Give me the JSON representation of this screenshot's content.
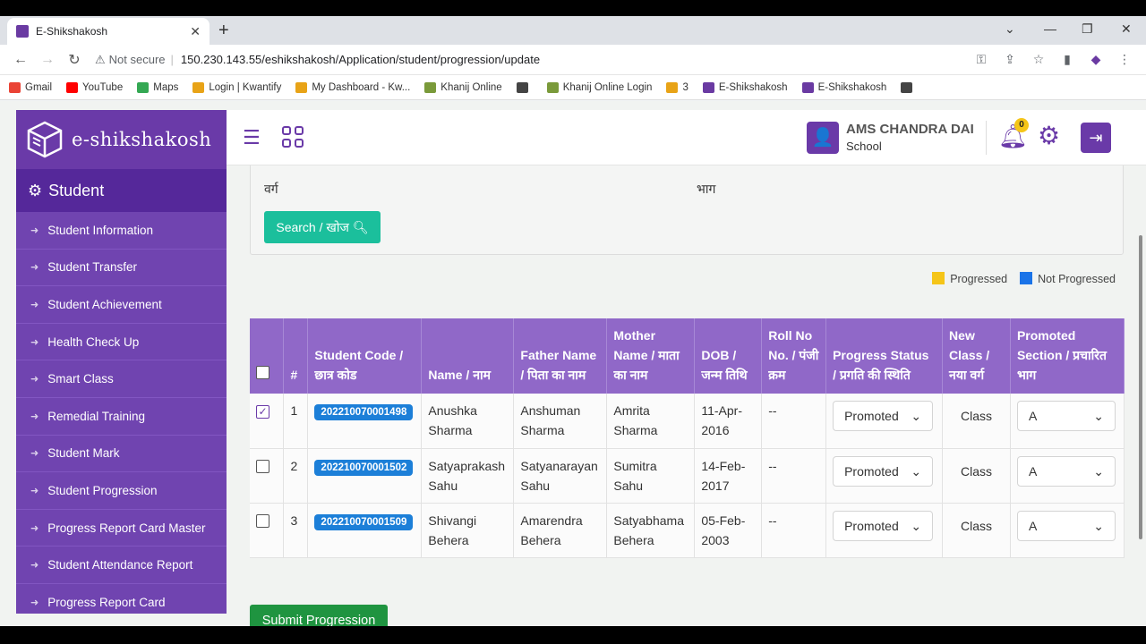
{
  "browser": {
    "tab_title": "E-Shikshakosh",
    "security_label": "Not secure",
    "url": "150.230.143.55/eshikshakosh/Application/student/progression/update",
    "bookmarks": [
      {
        "label": "Gmail",
        "color": "#ea4335"
      },
      {
        "label": "YouTube",
        "color": "#ff0000"
      },
      {
        "label": "Maps",
        "color": "#34a853"
      },
      {
        "label": "Login | Kwantify",
        "color": "#e8a317"
      },
      {
        "label": "My Dashboard - Kw...",
        "color": "#e8a317"
      },
      {
        "label": "Khanij Online",
        "color": "#7a9a3a"
      },
      {
        "label": "",
        "color": "#444444"
      },
      {
        "label": "Khanij Online Login",
        "color": "#7a9a3a"
      },
      {
        "label": "3",
        "color": "#e8a317"
      },
      {
        "label": "E-Shikshakosh",
        "color": "#6a3aa2"
      },
      {
        "label": "E-Shikshakosh",
        "color": "#6a3aa2"
      },
      {
        "label": "",
        "color": "#444444"
      }
    ]
  },
  "app": {
    "logo_text": "e-shikshakosh",
    "section_title": "Student",
    "menu": [
      "Student Information",
      "Student Transfer",
      "Student Achievement",
      "Health Check Up",
      "Smart Class",
      "Remedial Training",
      "Student Mark",
      "Student Progression",
      "Progress Report Card Master",
      "Student Attendance Report",
      "Progress Report Card"
    ],
    "user": {
      "name": "AMS CHANDRA DAI",
      "role": "School"
    },
    "notification_count": "0"
  },
  "filter": {
    "class_label": "वर्ग",
    "section_label": "भाग",
    "search_label": "Search / खोज"
  },
  "legend": {
    "progressed": "Progressed",
    "not_progressed": "Not Progressed",
    "progressed_color": "#f5c518",
    "not_progressed_color": "#1a73e8"
  },
  "table": {
    "headers": {
      "num": "#",
      "code": "Student Code / छात्र कोड",
      "name": "Name / नाम",
      "father": "Father Name / पिता का नाम",
      "mother": "Mother Name / माता का नाम",
      "dob": "DOB / जन्म तिथि",
      "roll": "Roll No No. / पंजी क्रम",
      "status": "Progress Status / प्रगति की स्थिति",
      "new_class": "New Class / नया वर्ग",
      "section": "Promoted Section / प्रचारित भाग"
    },
    "rows": [
      {
        "num": "1",
        "code": "202210070001498",
        "name": "Anushka Sharma",
        "father": "Anshuman Sharma",
        "mother": "Amrita Sharma",
        "dob": "11-Apr-2016",
        "roll": "--",
        "status": "Promoted",
        "new_class": "Class",
        "section": "A",
        "checked": true
      },
      {
        "num": "2",
        "code": "202210070001502",
        "name": "Satyaprakash Sahu",
        "father": "Satyanarayan Sahu",
        "mother": "Sumitra Sahu",
        "dob": "14-Feb-2017",
        "roll": "--",
        "status": "Promoted",
        "new_class": "Class",
        "section": "A",
        "checked": false
      },
      {
        "num": "3",
        "code": "202210070001509",
        "name": "Shivangi Behera",
        "father": "Amarendra Behera",
        "mother": "Satyabhama Behera",
        "dob": "05-Feb-2003",
        "roll": "--",
        "status": "Promoted",
        "new_class": "Class",
        "section": "A",
        "checked": false
      }
    ]
  },
  "submit_label": "Submit Progression"
}
